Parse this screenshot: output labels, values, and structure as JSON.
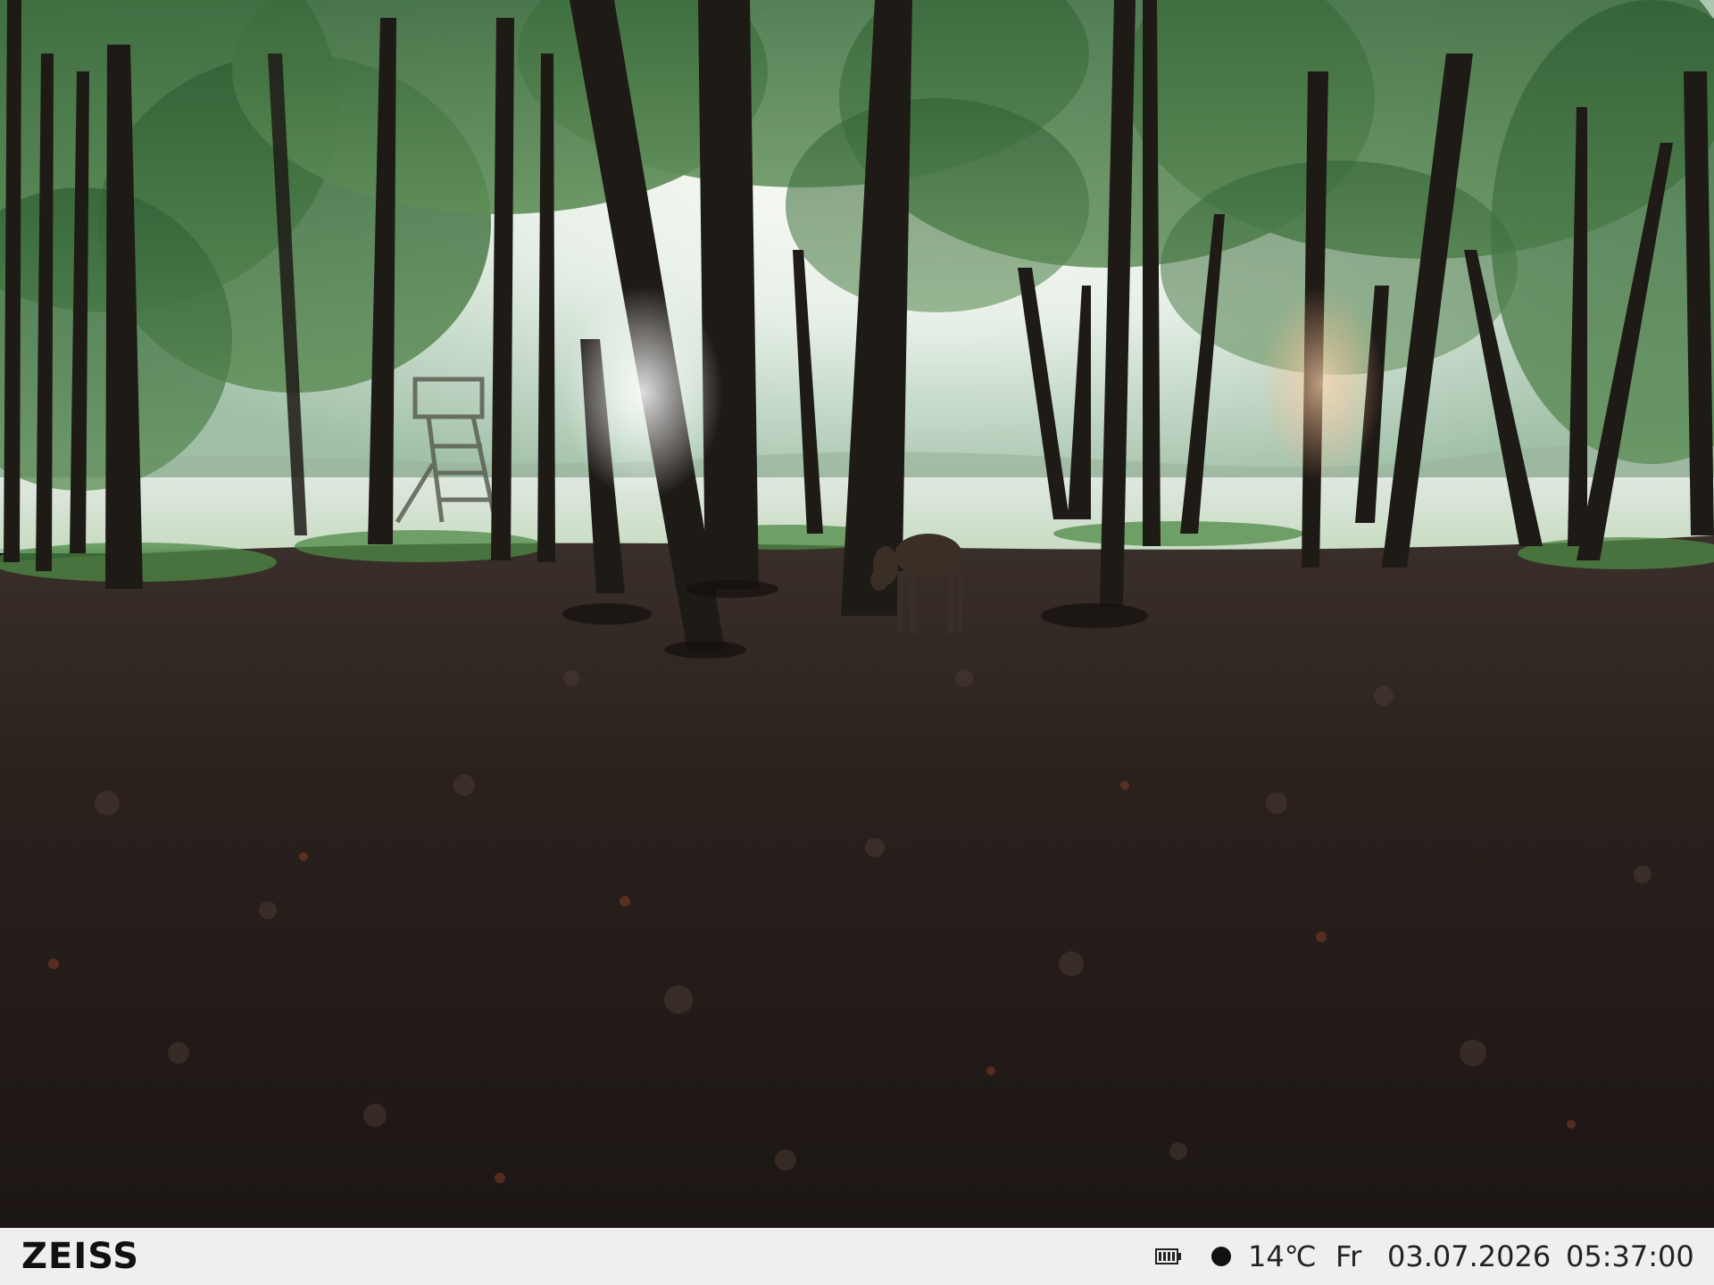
{
  "overlay": {
    "brand": "ZEISS",
    "temperature": "14℃",
    "weekday": "Fr",
    "date": "03.07.2026",
    "time": "05:37:00",
    "battery_icon": "battery-icon",
    "moon_phase_icon": "full-moon-icon"
  },
  "colors": {
    "info_bar_background": "#efefef",
    "info_text": "#1a1a1a",
    "sky_glow": "#f4f6ee",
    "canopy": "#3d6a3a",
    "forest_floor": "#231b17"
  }
}
